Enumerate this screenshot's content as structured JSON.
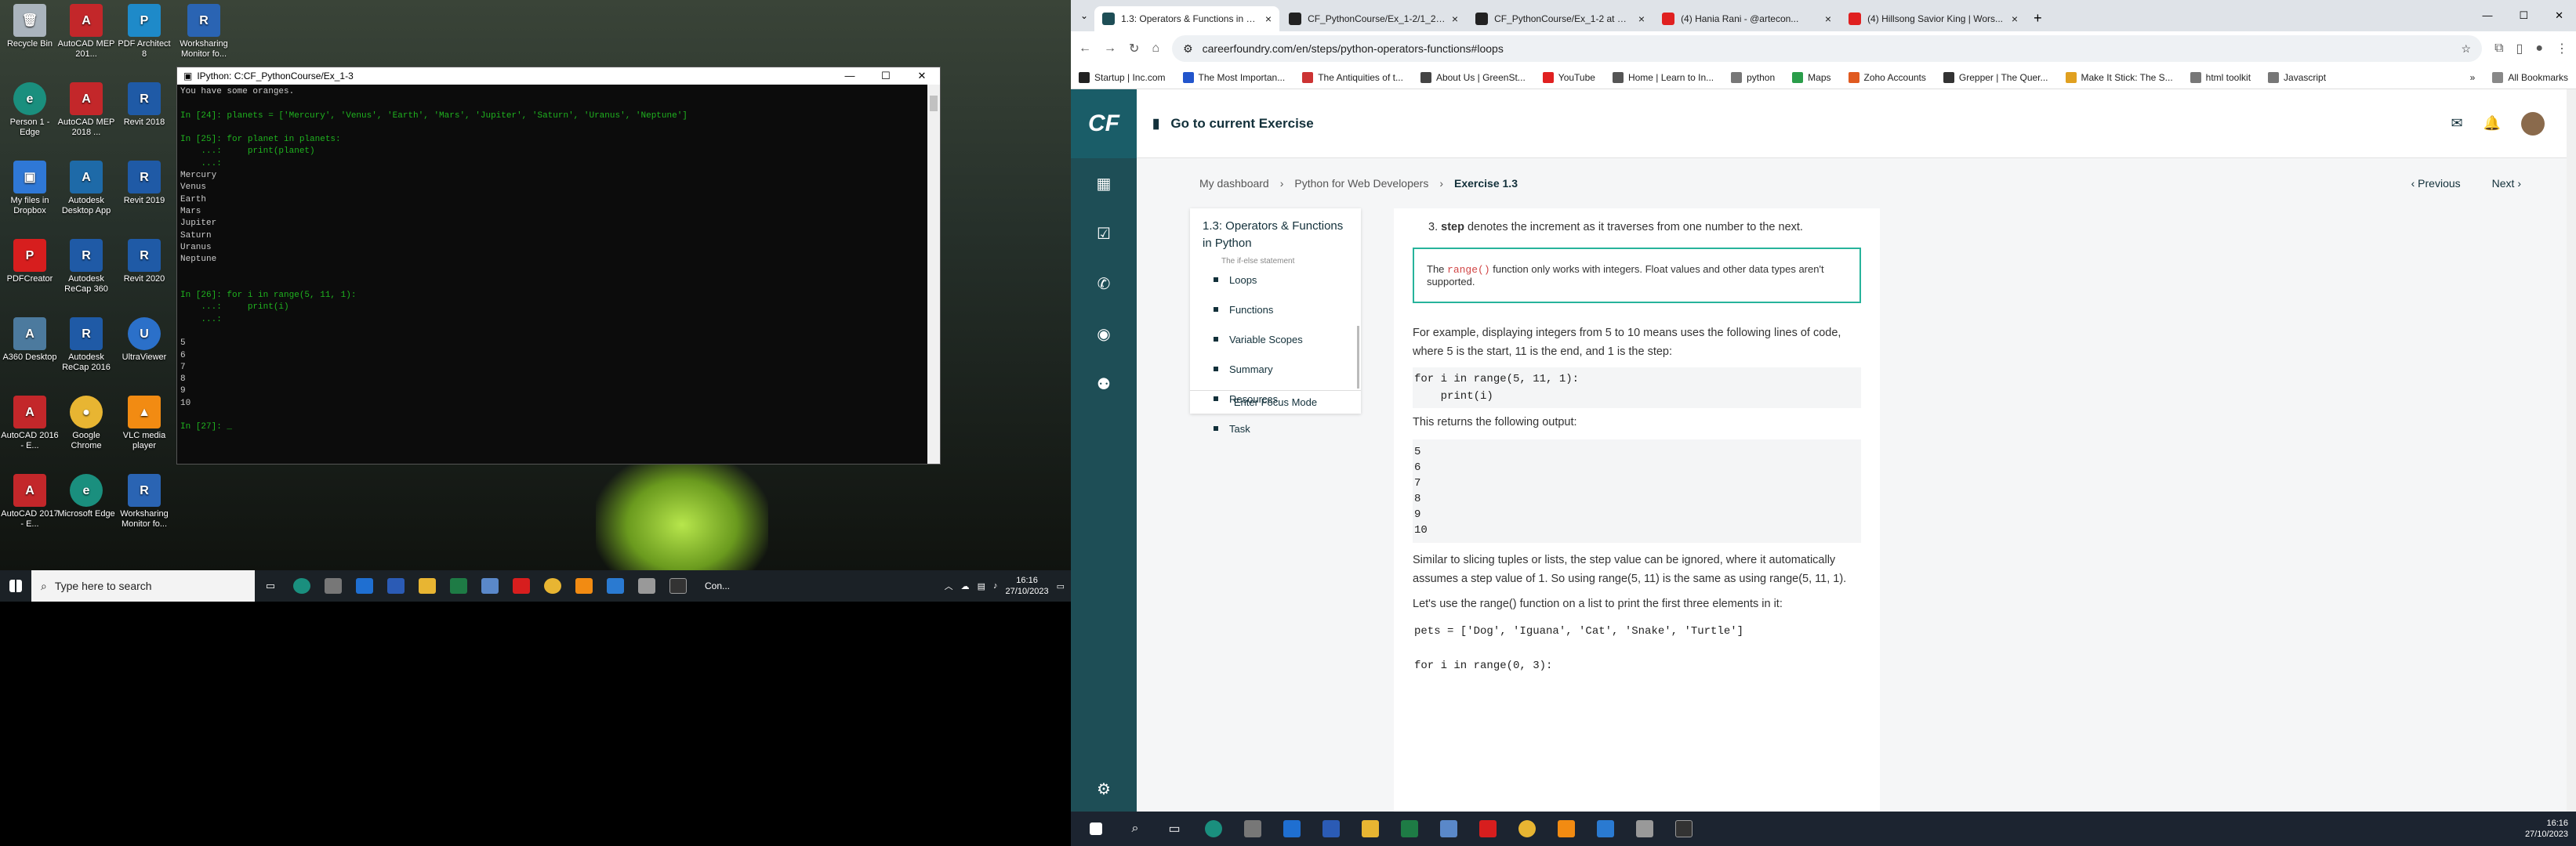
{
  "desktop": {
    "icons": [
      {
        "label": "Recycle Bin",
        "glyph": "🗑",
        "kind": "bin"
      },
      {
        "label": "AutoCAD MEP 201...",
        "glyph": "A",
        "kind": "autocad"
      },
      {
        "label": "PDF Architect 8",
        "glyph": "P",
        "kind": "arch"
      },
      {
        "label": "Worksharing Monitor fo...",
        "glyph": "R",
        "kind": "ws"
      },
      {
        "label": "Person 1 - Edge",
        "glyph": "e",
        "kind": "edge"
      },
      {
        "label": "AutoCAD MEP 2018 ...",
        "glyph": "A",
        "kind": "autocad"
      },
      {
        "label": "Revit 2018",
        "glyph": "R",
        "kind": "revit"
      },
      {
        "label": "My files in Dropbox",
        "glyph": "▣",
        "kind": "dropbox"
      },
      {
        "label": "Autodesk Desktop App",
        "glyph": "A",
        "kind": "desk"
      },
      {
        "label": "Revit 2019",
        "glyph": "R",
        "kind": "revit"
      },
      {
        "label": "PDFCreator",
        "glyph": "P",
        "kind": "pdf"
      },
      {
        "label": "Autodesk ReCap 360",
        "glyph": "R",
        "kind": "revit"
      },
      {
        "label": "Revit 2020",
        "glyph": "R",
        "kind": "revit"
      },
      {
        "label": "A360 Desktop",
        "glyph": "A",
        "kind": "a360"
      },
      {
        "label": "Autodesk ReCap 2016",
        "glyph": "R",
        "kind": "revit"
      },
      {
        "label": "UltraViewer",
        "glyph": "U",
        "kind": "uv"
      },
      {
        "label": "AutoCAD 2016 - E...",
        "glyph": "A",
        "kind": "autocad"
      },
      {
        "label": "Google Chrome",
        "glyph": "●",
        "kind": "chrome"
      },
      {
        "label": "VLC media player",
        "glyph": "▲",
        "kind": "vlc"
      },
      {
        "label": "AutoCAD 2017 - E...",
        "glyph": "A",
        "kind": "autocad"
      },
      {
        "label": "Microsoft Edge",
        "glyph": "e",
        "kind": "edge"
      },
      {
        "label": "Worksharing Monitor fo...",
        "glyph": "R",
        "kind": "ws"
      }
    ]
  },
  "terminal": {
    "title": "IPython: C:CF_PythonCourse/Ex_1-3",
    "lines": [
      "You have some oranges.",
      "",
      "In [24]: planets = ['Mercury', 'Venus', 'Earth', 'Mars', 'Jupiter', 'Saturn', 'Uranus', 'Neptune']",
      "",
      "In [25]: for planet in planets:",
      "    ...:     print(planet)",
      "    ...:",
      "Mercury",
      "Venus",
      "Earth",
      "Mars",
      "Jupiter",
      "Saturn",
      "Uranus",
      "Neptune",
      "",
      "",
      "In [26]: for i in range(5, 11, 1):",
      "    ...:     print(i)",
      "    ...:",
      "",
      "5",
      "6",
      "7",
      "8",
      "9",
      "10",
      "",
      "In [27]: _"
    ]
  },
  "taskbar_left": {
    "search_placeholder": "Type here to search",
    "console_label": "Con...",
    "time": "16:16",
    "date": "27/10/2023"
  },
  "browser": {
    "tabs": [
      {
        "title": "1.3: Operators & Functions in P...",
        "fav": "#1e4e56",
        "active": true
      },
      {
        "title": "CF_PythonCourse/Ex_1-2/1_2-E...",
        "fav": "#222222",
        "active": false
      },
      {
        "title": "CF_PythonCourse/Ex_1-2 at mai...",
        "fav": "#222222",
        "active": false
      },
      {
        "title": "(4) Hania Rani - @artecon...",
        "fav": "#e02020",
        "active": false
      },
      {
        "title": "(4) Hillsong Savior King | Wors...",
        "fav": "#e02020",
        "active": false
      }
    ],
    "url": "careerfoundry.com/en/steps/python-operators-functions#loops",
    "bookmarks": [
      {
        "label": "Startup | Inc.com",
        "color": "#222"
      },
      {
        "label": "The Most Importan...",
        "color": "#2255cc"
      },
      {
        "label": "The Antiquities of t...",
        "color": "#cc3333"
      },
      {
        "label": "About Us | GreenSt...",
        "color": "#444"
      },
      {
        "label": "YouTube",
        "color": "#e02020"
      },
      {
        "label": "Home | Learn to In...",
        "color": "#555"
      },
      {
        "label": "python",
        "color": "#777"
      },
      {
        "label": "Maps",
        "color": "#2a9d4a"
      },
      {
        "label": "Zoho Accounts",
        "color": "#e05a20"
      },
      {
        "label": "Grepper | The Quer...",
        "color": "#333"
      },
      {
        "label": "Make It Stick: The S...",
        "color": "#e0a020"
      },
      {
        "label": "html toolkit",
        "color": "#777"
      },
      {
        "label": "Javascript",
        "color": "#777"
      }
    ],
    "all_bookmarks": "All Bookmarks"
  },
  "cf": {
    "logo": "CF",
    "goto_exercise": "Go to current Exercise",
    "breadcrumbs": [
      "My dashboard",
      "Python for Web Developers",
      "Exercise 1.3"
    ],
    "prev": "Previous",
    "next": "Next",
    "toc_title": "1.3: Operators & Functions in Python",
    "toc_partial": "The if-else statement",
    "toc_items": [
      "Loops",
      "Functions",
      "Variable Scopes",
      "Summary",
      "Resources",
      "Task"
    ],
    "focus_mode": "Enter Focus Mode"
  },
  "article": {
    "step_term": "step",
    "step_text": " denotes the increment as it traverses from one number to the next.",
    "note_code": "range()",
    "note_text": " function only works with integers. Float values and other data types aren't supported.",
    "note_prefix": "The ",
    "example_text": "For example, displaying integers from 5 to 10 means uses the following lines of code, where 5 is the start, 11 is the end, and 1 is the step:",
    "code1_line1": "for i in range(5, 11, 1):",
    "code1_line2": "    print(i)",
    "returns_text": "This returns the following output:",
    "output": "5\n6\n7\n8\n9\n10",
    "slicing_text": "Similar to slicing tuples or lists, the step value can be ignored, where it automatically assumes a step value of 1. So using range(5, 11) is the same as using range(5, 11, 1).",
    "lets_use": "Let's use the range() function on a list to print the first three elements in it:",
    "pets_line": "pets = ['Dog', 'Iguana', 'Cat', 'Snake', 'Turtle']",
    "loop_line": "for i in range(0, 3):"
  },
  "taskbar_right": {
    "time": "16:16",
    "date": "27/10/2023"
  }
}
